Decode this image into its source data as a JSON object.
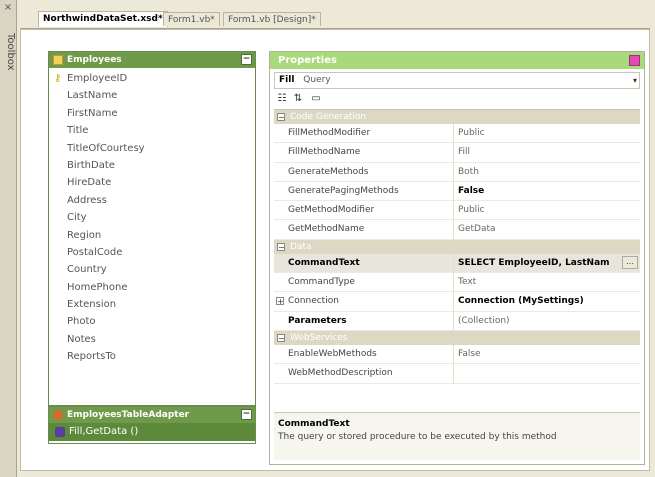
{
  "toolbox": {
    "label": "Toolbox",
    "close_glyph": "×"
  },
  "tabs": [
    {
      "label": "NorthwindDataSet.xsd*",
      "active": true
    },
    {
      "label": "Form1.vb*",
      "active": false
    },
    {
      "label": "Form1.vb [Design]*",
      "active": false
    }
  ],
  "employees_table": {
    "title": "Employees",
    "columns": [
      "EmployeeID",
      "LastName",
      "FirstName",
      "Title",
      "TitleOfCourtesy",
      "BirthDate",
      "HireDate",
      "Address",
      "City",
      "Region",
      "PostalCode",
      "Country",
      "HomePhone",
      "Extension",
      "Photo",
      "Notes",
      "ReportsTo"
    ]
  },
  "adapter": {
    "title": "EmployeesTableAdapter",
    "query": "Fill,GetData ()"
  },
  "properties": {
    "title": "Properties",
    "object_name": "Fill",
    "object_type": "Query",
    "categories": {
      "code_generation": "Code Generation",
      "data": "Data",
      "web_services": "WebServices"
    },
    "rows": {
      "fill_method_modifier": {
        "name": "FillMethodModifier",
        "value": "Public"
      },
      "fill_method_name": {
        "name": "FillMethodName",
        "value": "Fill"
      },
      "generate_methods": {
        "name": "GenerateMethods",
        "value": "Both"
      },
      "generate_paging_methods": {
        "name": "GeneratePagingMethods",
        "value": "False"
      },
      "get_method_modifier": {
        "name": "GetMethodModifier",
        "value": "Public"
      },
      "get_method_name": {
        "name": "GetMethodName",
        "value": "GetData"
      },
      "command_text": {
        "name": "CommandText",
        "value": "SELECT EmployeeID, LastNam"
      },
      "command_type": {
        "name": "CommandType",
        "value": "Text"
      },
      "connection": {
        "name": "Connection",
        "value": "Connection (MySettings)"
      },
      "parameters": {
        "name": "Parameters",
        "value": "(Collection)"
      },
      "enable_web_methods": {
        "name": "EnableWebMethods",
        "value": "False"
      },
      "web_method_description": {
        "name": "WebMethodDescription",
        "value": ""
      }
    },
    "description": {
      "title": "CommandText",
      "text": "The query or stored procedure to be executed by this method"
    }
  },
  "colors": {
    "table_header": "#6f9a49",
    "properties_header": "#a8d97a",
    "close_button": "#e04bb0"
  }
}
